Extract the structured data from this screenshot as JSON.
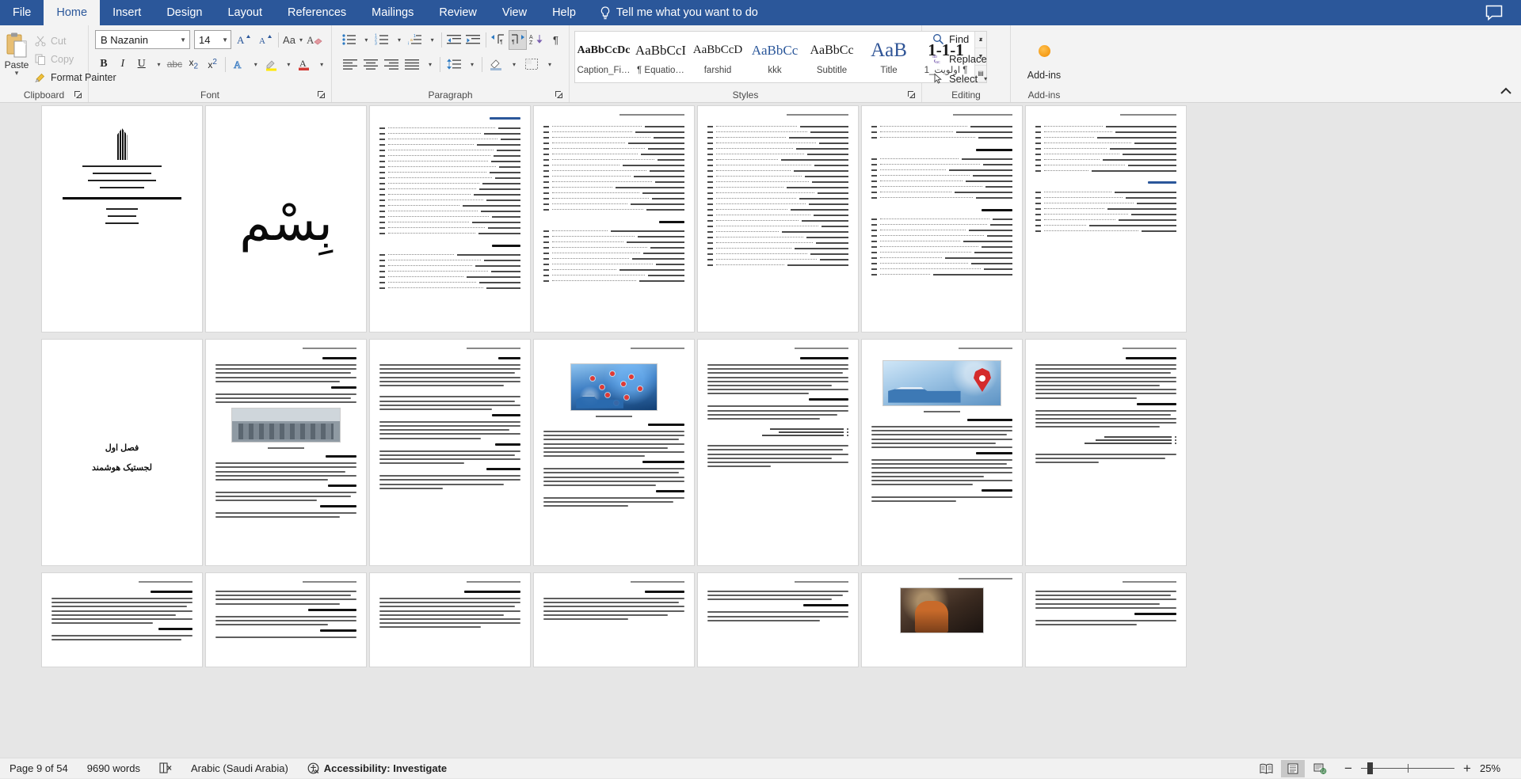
{
  "app": {
    "name": "Microsoft Word"
  },
  "titlebar": {
    "tabs": [
      {
        "label": "File",
        "name": "tab-file",
        "active": false
      },
      {
        "label": "Home",
        "name": "tab-home",
        "active": true
      },
      {
        "label": "Insert",
        "name": "tab-insert",
        "active": false
      },
      {
        "label": "Design",
        "name": "tab-design",
        "active": false
      },
      {
        "label": "Layout",
        "name": "tab-layout",
        "active": false
      },
      {
        "label": "References",
        "name": "tab-references",
        "active": false
      },
      {
        "label": "Mailings",
        "name": "tab-mailings",
        "active": false
      },
      {
        "label": "Review",
        "name": "tab-review",
        "active": false
      },
      {
        "label": "View",
        "name": "tab-view",
        "active": false
      },
      {
        "label": "Help",
        "name": "tab-help",
        "active": false
      }
    ],
    "tell_me": "Tell me what you want to do",
    "tell_me_icon": "lightbulb-icon",
    "comment_icon": "comment-icon",
    "accent_color": "#2b579a"
  },
  "ribbon": {
    "collapse_icon": "chevron-up-icon",
    "clipboard": {
      "label": "Clipboard",
      "paste": {
        "label": "Paste",
        "icon": "paste-icon"
      },
      "cut": {
        "label": "Cut",
        "icon": "scissors-icon",
        "enabled": false
      },
      "copy": {
        "label": "Copy",
        "icon": "copy-icon",
        "enabled": false
      },
      "format_painter": {
        "label": "Format Painter",
        "icon": "paintbrush-icon",
        "enabled": true
      },
      "launcher_icon": "dialog-launcher-icon"
    },
    "font": {
      "label": "Font",
      "family_value": "B Nazanin",
      "size_value": "14",
      "grow_icon": "grow-font-icon",
      "shrink_icon": "shrink-font-icon",
      "change_case_icon": "change-case-icon",
      "clear_formatting_icon": "clear-formatting-icon",
      "bold": "B",
      "italic": "I",
      "underline": "U",
      "strikethrough": "abc",
      "subscript": "x₂",
      "superscript": "x²",
      "text_effects_icon": "text-effects-icon",
      "highlight_icon": "highlight-color-icon",
      "font_color_icon": "font-color-icon",
      "launcher_icon": "dialog-launcher-icon"
    },
    "paragraph": {
      "label": "Paragraph",
      "bullets_icon": "bullets-icon",
      "numbering_icon": "numbering-icon",
      "multilevel_icon": "multilevel-list-icon",
      "decrease_indent_icon": "decrease-indent-icon",
      "increase_indent_icon": "increase-indent-icon",
      "ltr_icon": "left-to-right-icon",
      "rtl_icon": "right-to-left-icon",
      "sort_icon": "sort-icon",
      "show_marks_icon": "show-formatting-marks-icon",
      "align_left_icon": "align-left-icon",
      "align_center_icon": "align-center-icon",
      "align_right_icon": "align-right-icon",
      "justify_icon": "justify-icon",
      "line_spacing_icon": "line-spacing-icon",
      "shading_icon": "shading-icon",
      "borders_icon": "borders-icon",
      "launcher_icon": "dialog-launcher-icon",
      "rtl_active": true
    },
    "styles": {
      "label": "Styles",
      "items": [
        {
          "preview": "AaBbCcDс",
          "name": "Caption_Fi…"
        },
        {
          "preview": "AaBbCcI",
          "name": "¶ Equatio…"
        },
        {
          "preview": "AaBbCcD",
          "name": "farshid"
        },
        {
          "preview": "AaBbCc",
          "name": "kkk"
        },
        {
          "preview": "AaBbCc",
          "name": "Subtitle"
        },
        {
          "preview": "AaB",
          "name": "Title"
        },
        {
          "preview": "1-1-1",
          "name": "¶ اولویت_1"
        }
      ],
      "scroll_up_icon": "scroll-up-icon",
      "scroll_down_icon": "scroll-down-icon",
      "more_icon": "more-styles-icon",
      "launcher_icon": "dialog-launcher-icon"
    },
    "editing": {
      "label": "Editing",
      "find": {
        "label": "Find",
        "icon": "search-icon",
        "has_dropdown": true
      },
      "replace": {
        "label": "Replace",
        "icon": "replace-icon",
        "has_dropdown": false
      },
      "select": {
        "label": "Select",
        "icon": "cursor-icon",
        "has_dropdown": true
      }
    },
    "addins": {
      "label": "Add-ins",
      "button_label": "Add-ins",
      "icon": "addins-dot-icon",
      "icon_color": "#f08a00"
    }
  },
  "document": {
    "zoom_level": "25%",
    "rendered_pages": [
      {
        "kind": "cover",
        "index": 1,
        "lines": [
          "دانشگاه جامع علمی کاربردی",
          "مرکز آموزش علمی کاربردی",
          "پروژه دوره کاردانی حرفه ای",
          "مدیریت کسب و کار",
          "\"هوشمندسازی سیستم لجستیک و توزیع میدان تره بار مرکزی تهران\"",
          "ارائه شده به:",
          "نام استاد:",
          "تهیه کنندگان:"
        ]
      },
      {
        "kind": "calligraphy",
        "index": 2,
        "glyph": "بِسْمِ اللّٰه"
      },
      {
        "kind": "toc",
        "index": 3,
        "heading": "فهرست مطالب",
        "rows": 24
      },
      {
        "kind": "toc",
        "index": 4,
        "heading": "",
        "rows": 27
      },
      {
        "kind": "toc",
        "index": 5,
        "heading": "",
        "rows": 27
      },
      {
        "kind": "toc",
        "index": 6,
        "heading": "فهرست اشکال",
        "rows": 26
      },
      {
        "kind": "toc",
        "index": 7,
        "heading": "فهرست جداول",
        "rows": 22
      },
      {
        "kind": "chapter",
        "index": 8,
        "title_1": "فصل اول",
        "title_2": "لجستیک هوشمند"
      },
      {
        "kind": "text-figure",
        "index": 9,
        "header": "فصل اول لجستیک هوشمند",
        "figure": "factory",
        "page_no": "1"
      },
      {
        "kind": "text",
        "index": 10,
        "header": "فصل اول لجستیک هوشمند",
        "page_no": "3"
      },
      {
        "kind": "figure-blue",
        "index": 11,
        "header": "فصل اول لجستیک هوشمند",
        "page_no": "4"
      },
      {
        "kind": "text",
        "index": 12,
        "header": "فصل اول لجستیک هوشمند",
        "page_no": "5"
      },
      {
        "kind": "figure-truck",
        "index": 13,
        "header": "فصل اول لجستیک هوشمند",
        "page_no": "7"
      },
      {
        "kind": "text",
        "index": 14,
        "header": "فصل اول لجستیک هوشمند"
      },
      {
        "kind": "text",
        "index": 15,
        "header": "فصل اول لجستیک هوشمند"
      },
      {
        "kind": "text",
        "index": 16,
        "header": "فصل اول لجستیک هوشمند"
      },
      {
        "kind": "figure-dark",
        "index": 17,
        "header": "فصل اول لجستیک هوشمند"
      },
      {
        "kind": "text",
        "index": 18,
        "header": "فصل اول لجستیک هوشمند"
      }
    ]
  },
  "statusbar": {
    "page_info": "Page 9 of 54",
    "word_count": "9690 words",
    "proofing_icon": "proofing-errors-icon",
    "language": "Arabic (Saudi Arabia)",
    "accessibility_icon": "accessibility-icon",
    "accessibility": "Accessibility: Investigate",
    "views": [
      {
        "name": "view-read-mode",
        "icon": "read-mode-icon",
        "active": false
      },
      {
        "name": "view-print-layout",
        "icon": "print-layout-icon",
        "active": true
      },
      {
        "name": "view-web-layout",
        "icon": "web-layout-icon",
        "active": false
      }
    ],
    "zoom_out_label": "−",
    "zoom_in_label": "+",
    "zoom_value": "25%"
  }
}
